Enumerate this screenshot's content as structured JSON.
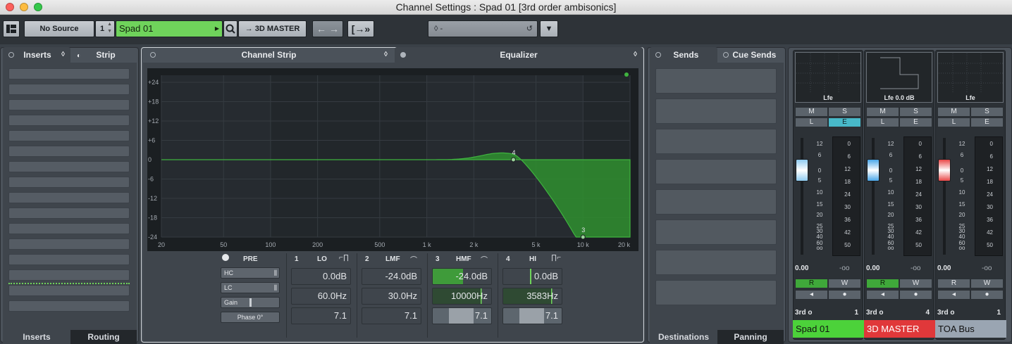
{
  "window": {
    "title": "Channel Settings : Spad 01 [3rd order ambisonics]"
  },
  "toolbar": {
    "source": "No Source",
    "channel_number": "1",
    "channel_name": "Spad 01",
    "output": "3D MASTER",
    "preset": "-"
  },
  "inserts_panel": {
    "tab_inserts": "Inserts",
    "tab_strip": "Strip",
    "bottom_inserts": "Inserts",
    "bottom_routing": "Routing"
  },
  "center": {
    "tab_channel_strip": "Channel Strip",
    "tab_equalizer": "Equalizer"
  },
  "eq": {
    "y_labels": [
      "+24",
      "+18",
      "+12",
      "+6",
      "0",
      "-6",
      "-12",
      "-18",
      "-24"
    ],
    "x_labels": [
      "20",
      "50",
      "100",
      "200",
      "500",
      "1 k",
      "2 k",
      "5 k",
      "10 k",
      "20 k"
    ],
    "node_labels": [
      "4",
      "3"
    ],
    "curve_color": "#2f8f2f"
  },
  "channel_strip_controls": {
    "pre": "PRE",
    "hc": "HC",
    "lc": "LC",
    "gain": "Gain",
    "phase": "Phase 0°"
  },
  "bands": [
    {
      "num": "1",
      "name": "LO",
      "gain": "0.0dB",
      "freq": "60.0Hz",
      "q": "7.1"
    },
    {
      "num": "2",
      "name": "LMF",
      "gain": "-24.0dB",
      "freq": "30.0Hz",
      "q": "7.1"
    },
    {
      "num": "3",
      "name": "HMF",
      "gain": "-24.0dB",
      "freq": "10000Hz",
      "q": "7.1"
    },
    {
      "num": "4",
      "name": "HI",
      "gain": "0.0dB",
      "freq": "3583Hz",
      "q": "7.1"
    }
  ],
  "sends_panel": {
    "tab_sends": "Sends",
    "tab_cue_sends": "Cue Sends",
    "bottom_destinations": "Destinations",
    "bottom_panning": "Panning"
  },
  "channels": [
    {
      "scope_label": "Lfe",
      "volume": "0.00",
      "peak": "-oo",
      "format": "3rd o",
      "bus_num": "1",
      "name": "Spad 01",
      "color": "#4cd23a",
      "fader_color": "#8fcbf0",
      "meter_scale": [
        "0",
        "6",
        "12",
        "18",
        "24",
        "30",
        "36",
        "42",
        "50"
      ],
      "fader_scale": [
        "12",
        "6",
        "0",
        "5",
        "10",
        "15",
        "20",
        "25",
        "30",
        "40",
        "60",
        "oo"
      ]
    },
    {
      "scope_label": "Lfe 0.0 dB",
      "volume": "0.00",
      "peak": "-oo",
      "format": "3rd o",
      "bus_num": "4",
      "name": "3D MASTER",
      "color": "#e0383a",
      "fader_color": "#4aa6e8",
      "meter_scale": [
        "0",
        "6",
        "12",
        "18",
        "24",
        "30",
        "36",
        "42",
        "50"
      ],
      "fader_scale": [
        "12",
        "6",
        "0",
        "5",
        "10",
        "15",
        "20",
        "25",
        "30",
        "40",
        "60",
        "oo"
      ]
    },
    {
      "scope_label": "Lfe",
      "volume": "0.00",
      "peak": "-oo",
      "format": "3rd o",
      "bus_num": "1",
      "name": "TOA Bus",
      "color": "#9aa5b2",
      "fader_color": "#e84848",
      "meter_scale": [
        "0",
        "6",
        "12",
        "18",
        "24",
        "30",
        "36",
        "42",
        "50"
      ],
      "fader_scale": [
        "12",
        "6",
        "0",
        "5",
        "10",
        "15",
        "20",
        "25",
        "30",
        "40",
        "60",
        "oo"
      ]
    }
  ],
  "strip_buttons": {
    "m": "M",
    "s": "S",
    "l": "L",
    "e": "E",
    "r": "R",
    "w": "W"
  }
}
